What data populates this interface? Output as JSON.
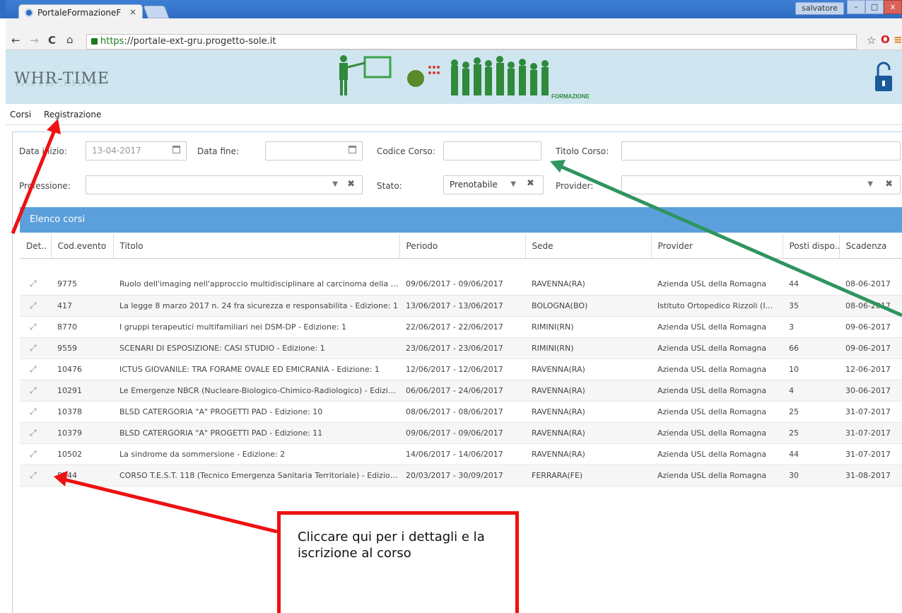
{
  "browser": {
    "tab_title": "PortaleFormazioneF",
    "tab_close": "×",
    "user": "salvatore",
    "win_min": "–",
    "win_max": "□",
    "win_close": "x",
    "url_scheme": "https",
    "url_rest": "://portale-ext-gru.progetto-sole.it",
    "nav_back": "←",
    "nav_forward": "→",
    "nav_reload": "C",
    "nav_home": "⌂",
    "star": "☆",
    "opera": "O",
    "menu_icon": "≡"
  },
  "header": {
    "logo": "WHR-TIME",
    "banner_label": "FORMAZIONE"
  },
  "menu": {
    "items": [
      "Corsi",
      "Registrazione"
    ]
  },
  "filters": {
    "data_inizio_label": "Data inizio:",
    "data_inizio_value": "13-04-2017",
    "data_fine_label": "Data fine:",
    "data_fine_value": "",
    "codice_label": "Codice Corso:",
    "titolo_label": "Titolo Corso:",
    "professione_label": "Professione:",
    "stato_label": "Stato:",
    "stato_value": "Prenotabile",
    "provider_label": "Provider:"
  },
  "list": {
    "title": "Elenco corsi",
    "columns": [
      "Det..",
      "Cod.evento",
      "Titolo",
      "Periodo",
      "Sede",
      "Provider",
      "Posti dispo...",
      "Scadenza"
    ],
    "expand_icon": "⤢",
    "rows": [
      [
        "9775",
        "Ruolo dell'imaging nell'approccio multidisciplinare al carcinoma della pr...",
        "09/06/2017 - 09/06/2017",
        "RAVENNA(RA)",
        "Azienda USL della Romagna",
        "44",
        "08-06-2017"
      ],
      [
        "417",
        "La legge 8 marzo 2017 n. 24 fra sicurezza e responsabilita - Edizione: 1",
        "13/06/2017 - 13/06/2017",
        "BOLOGNA(BO)",
        "Istituto Ortopedico Rizzoli (I...",
        "35",
        "08-06-2017"
      ],
      [
        "8770",
        "I gruppi terapeutici multifamiliari nei DSM-DP - Edizione: 1",
        "22/06/2017 - 22/06/2017",
        "RIMINI(RN)",
        "Azienda USL della Romagna",
        "3",
        "09-06-2017"
      ],
      [
        "9559",
        "SCENARI DI ESPOSIZIONE: CASI STUDIO - Edizione: 1",
        "23/06/2017 - 23/06/2017",
        "RIMINI(RN)",
        "Azienda USL della Romagna",
        "66",
        "09-06-2017"
      ],
      [
        "10476",
        "ICTUS GIOVANILE: TRA FORAME OVALE ED EMICRANIA - Edizione: 1",
        "12/06/2017 - 12/06/2017",
        "RAVENNA(RA)",
        "Azienda USL della Romagna",
        "10",
        "12-06-2017"
      ],
      [
        "10291",
        "Le Emergenze NBCR (Nucleare-Biologico-Chimico-Radiologico) - Edizion...",
        "06/06/2017 - 24/06/2017",
        "RAVENNA(RA)",
        "Azienda USL della Romagna",
        "4",
        "30-06-2017"
      ],
      [
        "10378",
        "BLSD CATERGORIA \"A\" PROGETTI PAD - Edizione: 10",
        "08/06/2017 - 08/06/2017",
        "RAVENNA(RA)",
        "Azienda USL della Romagna",
        "25",
        "31-07-2017"
      ],
      [
        "10379",
        "BLSD CATERGORIA \"A\" PROGETTI PAD - Edizione: 11",
        "09/06/2017 - 09/06/2017",
        "RAVENNA(RA)",
        "Azienda USL della Romagna",
        "25",
        "31-07-2017"
      ],
      [
        "10502",
        "La sindrome da sommersione - Edizione: 2",
        "14/06/2017 - 14/06/2017",
        "RAVENNA(RA)",
        "Azienda USL della Romagna",
        "44",
        "31-07-2017"
      ],
      [
        "8744",
        "CORSO T.E.S.T. 118 (Tecnico Emergenza Sanitaria Territoriale) - Edizione:...",
        "20/03/2017 - 30/09/2017",
        "FERRARA(FE)",
        "Azienda USL della Romagna",
        "30",
        "31-08-2017"
      ]
    ]
  },
  "annotation": {
    "text": "Cliccare qui per i dettagli e la iscrizione al corso",
    "red": "#ee1111",
    "green": "#2e9460"
  }
}
